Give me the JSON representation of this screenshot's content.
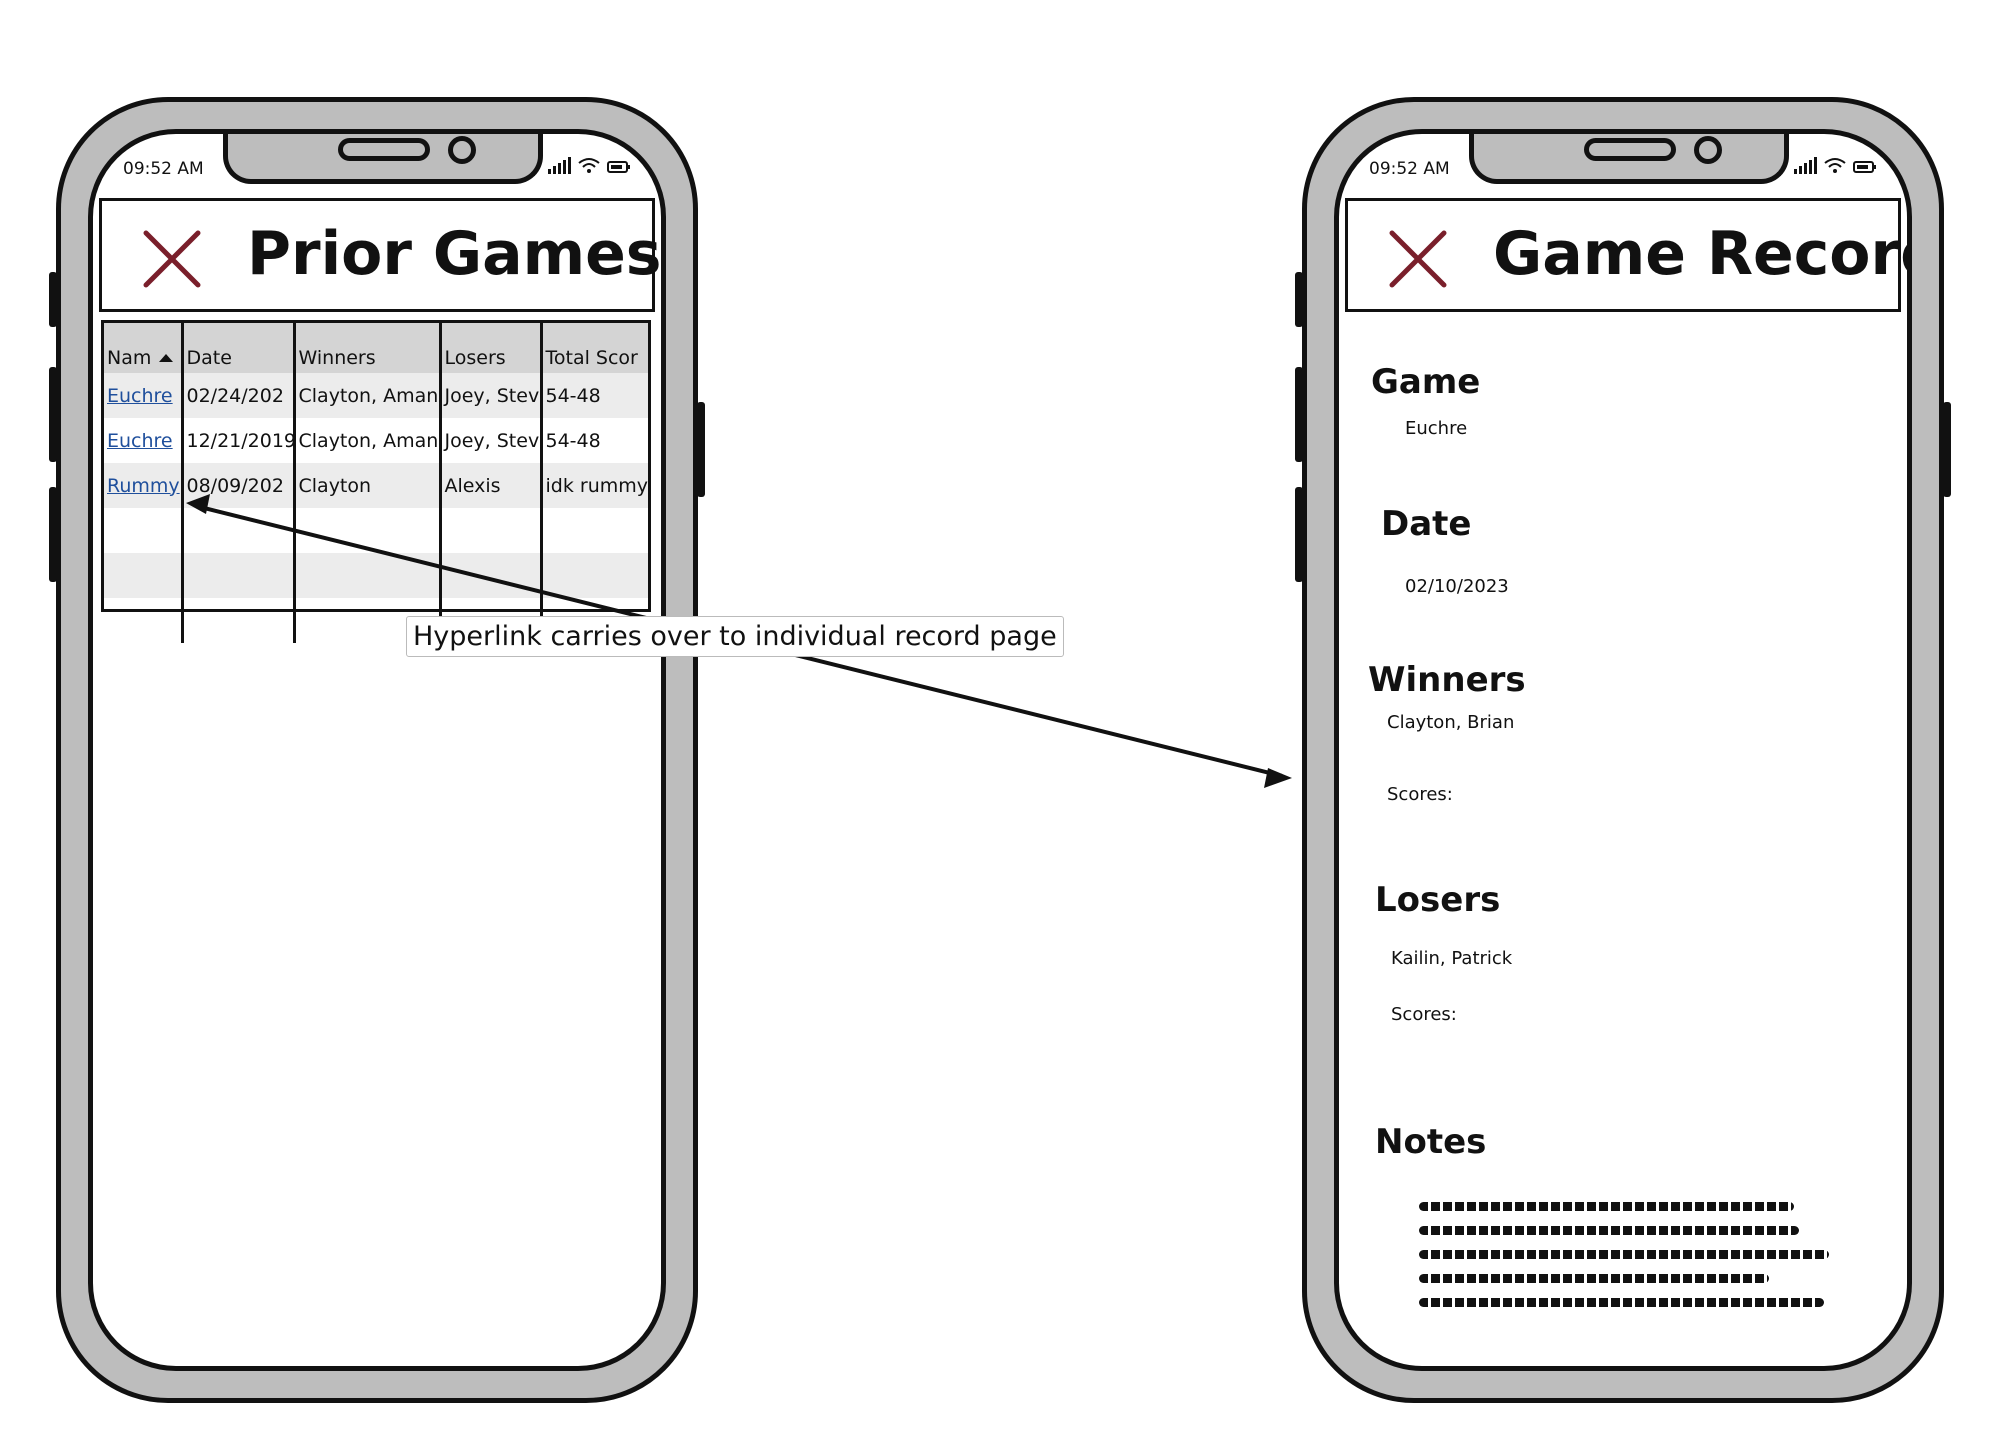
{
  "status_bar": {
    "time": "09:52 AM"
  },
  "left_screen": {
    "title": "Prior Games",
    "table": {
      "headers": [
        "Nam",
        "Date",
        "Winners",
        "Losers",
        "Total Scor"
      ],
      "rows": [
        [
          "Euchre",
          "02/24/202",
          "Clayton, Amand",
          "Joey, Stev",
          "54-48"
        ],
        [
          "Euchre",
          "12/21/2019",
          "Clayton, Amand",
          "Joey, Stev",
          "54-48"
        ],
        [
          "Rummy",
          "08/09/202",
          "Clayton",
          "Alexis",
          "idk rummy"
        ]
      ]
    }
  },
  "right_screen": {
    "title": "Game Record",
    "game_label": "Game",
    "game_value": "Euchre",
    "date_label": "Date",
    "date_value": "02/10/2023",
    "winners_label": "Winners",
    "winners_value": "Clayton, Brian",
    "winners_scores_label": "Scores:",
    "losers_label": "Losers",
    "losers_value": "Kailin, Patrick",
    "losers_scores_label": "Scores:",
    "notes_label": "Notes"
  },
  "annotation": {
    "callout": "Hyperlink carries over to individual record page"
  },
  "colors": {
    "close_icon": "#7a1f2b",
    "link": "#1f4f9c",
    "phone_frame": "#bdbdbd"
  }
}
